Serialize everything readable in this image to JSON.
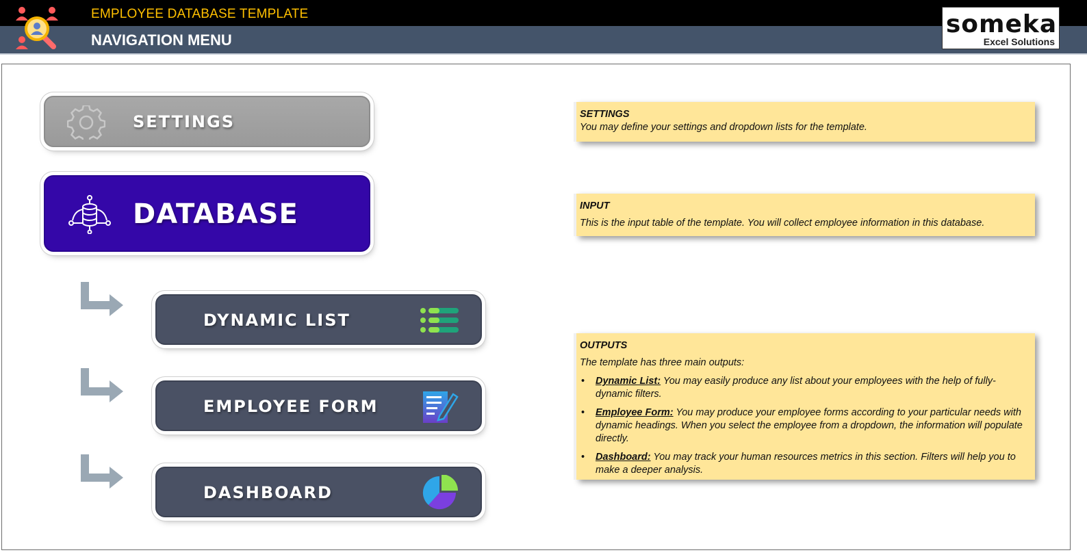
{
  "header": {
    "app_title": "EMPLOYEE DATABASE TEMPLATE",
    "page_title": "NAVIGATION MENU",
    "brand_name": "someka",
    "brand_sub": "Excel Solutions",
    "colors": {
      "top_bar": "#000000",
      "sub_bar": "#44546a",
      "title_accent": "#ffc000"
    }
  },
  "nav": {
    "settings": {
      "label": "SETTINGS",
      "icon": "gear-icon",
      "color": "#a0a0a0"
    },
    "database": {
      "label": "DATABASE",
      "icon": "database-network-icon",
      "color": "#3407a8"
    },
    "dynamic_list": {
      "label": "DYNAMIC LIST",
      "icon": "list-icon",
      "color": "#4a5164"
    },
    "employee_form": {
      "label": "EMPLOYEE FORM",
      "icon": "form-edit-icon",
      "color": "#4a5164"
    },
    "dashboard": {
      "label": "DASHBOARD",
      "icon": "pie-chart-icon",
      "color": "#4a5164"
    }
  },
  "notes": {
    "settings": {
      "title": "SETTINGS",
      "text": "You may define your settings and dropdown lists for the template."
    },
    "input": {
      "title": "INPUT",
      "text": "This is the input table of the template. You will collect employee information in this database."
    },
    "outputs": {
      "title": "OUTPUTS",
      "intro": "The template has three main outputs:",
      "items": [
        {
          "term": "Dynamic List:",
          "text": " You may easily produce any list about your employees with the help of fully-dynamic filters."
        },
        {
          "term": "Employee Form:",
          "text": " You may produce your employee forms according to your particular needs with dynamic headings. When you select the employee from a dropdown, the information will populate directly."
        },
        {
          "term": "Dashboard:",
          "text": " You may track your human resources metrics in this section. Filters will help you to make a deeper analysis."
        }
      ],
      "background": "#ffe699"
    }
  }
}
